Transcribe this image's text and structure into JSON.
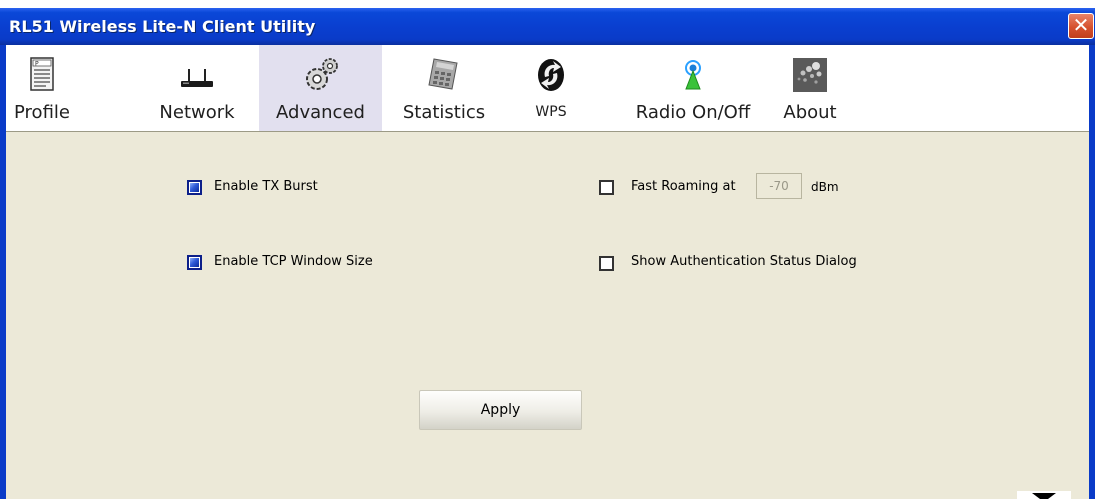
{
  "window": {
    "title": "RL51 Wireless Lite-N Client Utility",
    "close_glyph": "✕"
  },
  "toolbar": {
    "active_tab": "Advanced",
    "tabs": [
      {
        "label": "Profile",
        "icon": "profile-icon"
      },
      {
        "label": "Network",
        "icon": "network-icon"
      },
      {
        "label": "Advanced",
        "icon": "advanced-icon"
      },
      {
        "label": "Statistics",
        "icon": "statistics-icon"
      },
      {
        "label": "WPS",
        "icon": "wps-icon"
      },
      {
        "label": "Radio On/Off",
        "icon": "radio-icon"
      },
      {
        "label": "About",
        "icon": "about-icon"
      }
    ]
  },
  "advanced": {
    "tx_burst": {
      "label": "Enable TX Burst",
      "checked": true
    },
    "tcp_window": {
      "label": "Enable TCP Window Size",
      "checked": true
    },
    "fast_roaming": {
      "label": "Fast Roaming at",
      "checked": false,
      "value": "-70",
      "unit": "dBm"
    },
    "auth_status": {
      "label": "Show Authentication Status Dialog",
      "checked": false
    },
    "apply_label": "Apply"
  },
  "colors": {
    "titlebar": "#0a3fd0",
    "content_bg": "#ece9d8",
    "active_tab_bg": "#e2e0ef"
  }
}
